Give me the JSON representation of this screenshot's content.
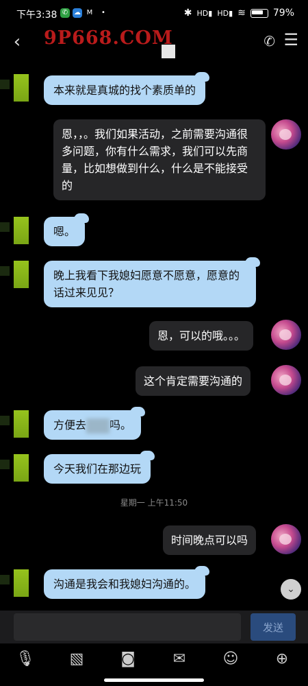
{
  "status_bar": {
    "time": "下午3:38",
    "battery": "79%",
    "signal_labels": [
      "HD",
      "HD"
    ]
  },
  "header": {
    "title": "9P668.COM"
  },
  "messages": [
    {
      "side": "in",
      "text": "本来就是真城的找个素质单的"
    },
    {
      "side": "out",
      "text": "恩，，。我们如果活动，之前需要沟通很多问题，你有什么需求，我们可以先商量，比如想做到什么，什么是不能接受的"
    },
    {
      "side": "in",
      "text": "嗯。"
    },
    {
      "side": "in",
      "text": "晚上我看下我媳妇愿意不愿意，愿意的话过来见见？"
    },
    {
      "side": "out",
      "text": "恩，可以的哦。。。"
    },
    {
      "side": "out",
      "text": "这个肯定需要沟通的"
    },
    {
      "side": "in",
      "text_before": "方便去",
      "text_after": "吗。"
    },
    {
      "side": "in",
      "text": "今天我们在那边玩"
    },
    {
      "side": "out",
      "text": "时间晚点可以吗"
    },
    {
      "side": "in",
      "text": "沟通是我会和我媳妇沟通的。"
    }
  ],
  "timestamp": "星期一 上午11:50",
  "input": {
    "placeholder": "",
    "send_label": "发送"
  },
  "colors": {
    "incoming_bubble": "#b3d8f6",
    "outgoing_bubble": "#262628",
    "title": "#b91b1b"
  }
}
